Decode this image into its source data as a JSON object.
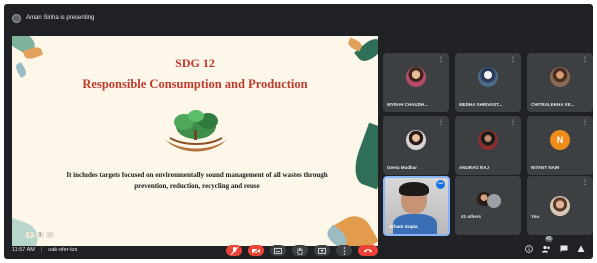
{
  "presenter": {
    "label": "Aman Sinha is presenting"
  },
  "slide": {
    "title_line1": "SDG 12",
    "title_line2": "Responsible Consumption and Production",
    "body": "It includes targets focused on environmentally sound management of all wastes through prevention, reduction, recycling and reuse",
    "pager": [
      "‹",
      "1",
      "›"
    ]
  },
  "participants": [
    {
      "name": "MYRAH CHAUDH...",
      "avatar": "photo"
    },
    {
      "name": "MEDHA SHRIVAST...",
      "avatar": "photo"
    },
    {
      "name": "CHITRALEKHA VE...",
      "avatar": "photo"
    },
    {
      "name": "Geeta Mudhar",
      "avatar": "photo"
    },
    {
      "name": "ANURAG RAJ",
      "avatar": "photo"
    },
    {
      "name": "NITANT NAIR",
      "avatar": "N"
    },
    {
      "name": "Arham Gupta",
      "avatar": "video"
    },
    {
      "name": "41 others",
      "avatar": "group"
    },
    {
      "name": "You",
      "avatar": "photo"
    }
  ],
  "footer": {
    "time": "11:57 AM",
    "separator": "|",
    "meeting_code": "uak-ofer-tzs"
  },
  "controls": [
    "mic-off-icon",
    "camera-off-icon",
    "captions-icon",
    "raise-hand-icon",
    "present-icon",
    "more-icon",
    "end-call-icon"
  ],
  "right_controls": {
    "people_count": "45"
  },
  "colors": {
    "background": "#202124",
    "tile": "#3c4043",
    "danger": "#ea4335",
    "accent": "#8ab4f8",
    "slide_title": "#c0392b",
    "slide_bg": "#fdf7ea"
  }
}
